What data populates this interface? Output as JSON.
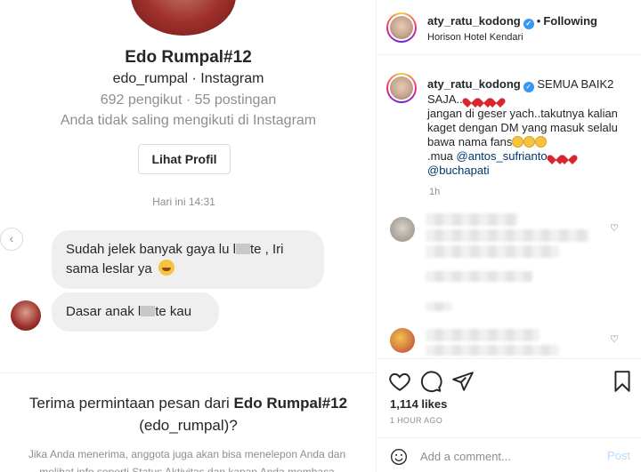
{
  "dm": {
    "name": "Edo Rumpal#12",
    "handle": "edo_rumpal · Instagram",
    "stats": "692 pengikut · 55 postingan",
    "follow_status": "Anda tidak saling mengikuti di Instagram",
    "profile_button": "Lihat Profil",
    "timestamp": "Hari ini 14:31",
    "msg1_a": "Sudah jelek banyak gaya lu l",
    "msg1_b": "te , Iri",
    "msg1_c": "sama leslar ya",
    "msg2_a": "Dasar anak l",
    "msg2_b": "te kau",
    "request_prefix": "Terima permintaan pesan dari ",
    "request_name": "Edo Rumpal#12",
    "request_handle": "(edo_rumpal)?",
    "request_body": "Jika Anda menerima, anggota juga akan bisa menelepon Anda dan melihat info seperti Status Aktivitas dan kapan Anda membaca"
  },
  "post": {
    "username": "aty_ratu_kodong",
    "following": "Following",
    "location": "Horison Hotel Kendari",
    "caption_user": "aty_ratu_kodong",
    "caption_line1": "SEMUA BAIK2 SAJA...",
    "caption_line2": "jangan di geser yach..takutnya kalian kaget dengan DM yang masuk selalu bawa nama fans",
    "caption_mua": ".mua ",
    "mention1": "@antos_sufrianto",
    "mention2": "@buchapati",
    "caption_time": "1h",
    "likes": "1,114 likes",
    "ago": "1 HOUR AGO",
    "comment_placeholder": "Add a comment...",
    "post_label": "Post"
  },
  "icons": [
    "verified-icon",
    "heart-icon",
    "comment-icon",
    "share-icon",
    "bookmark-icon",
    "smile-icon",
    "chevron-left-icon"
  ],
  "colors": {
    "link": "#00376b",
    "verified": "#3897f0",
    "muted": "#8e8e8e",
    "post_disabled": "#b3dbff"
  }
}
